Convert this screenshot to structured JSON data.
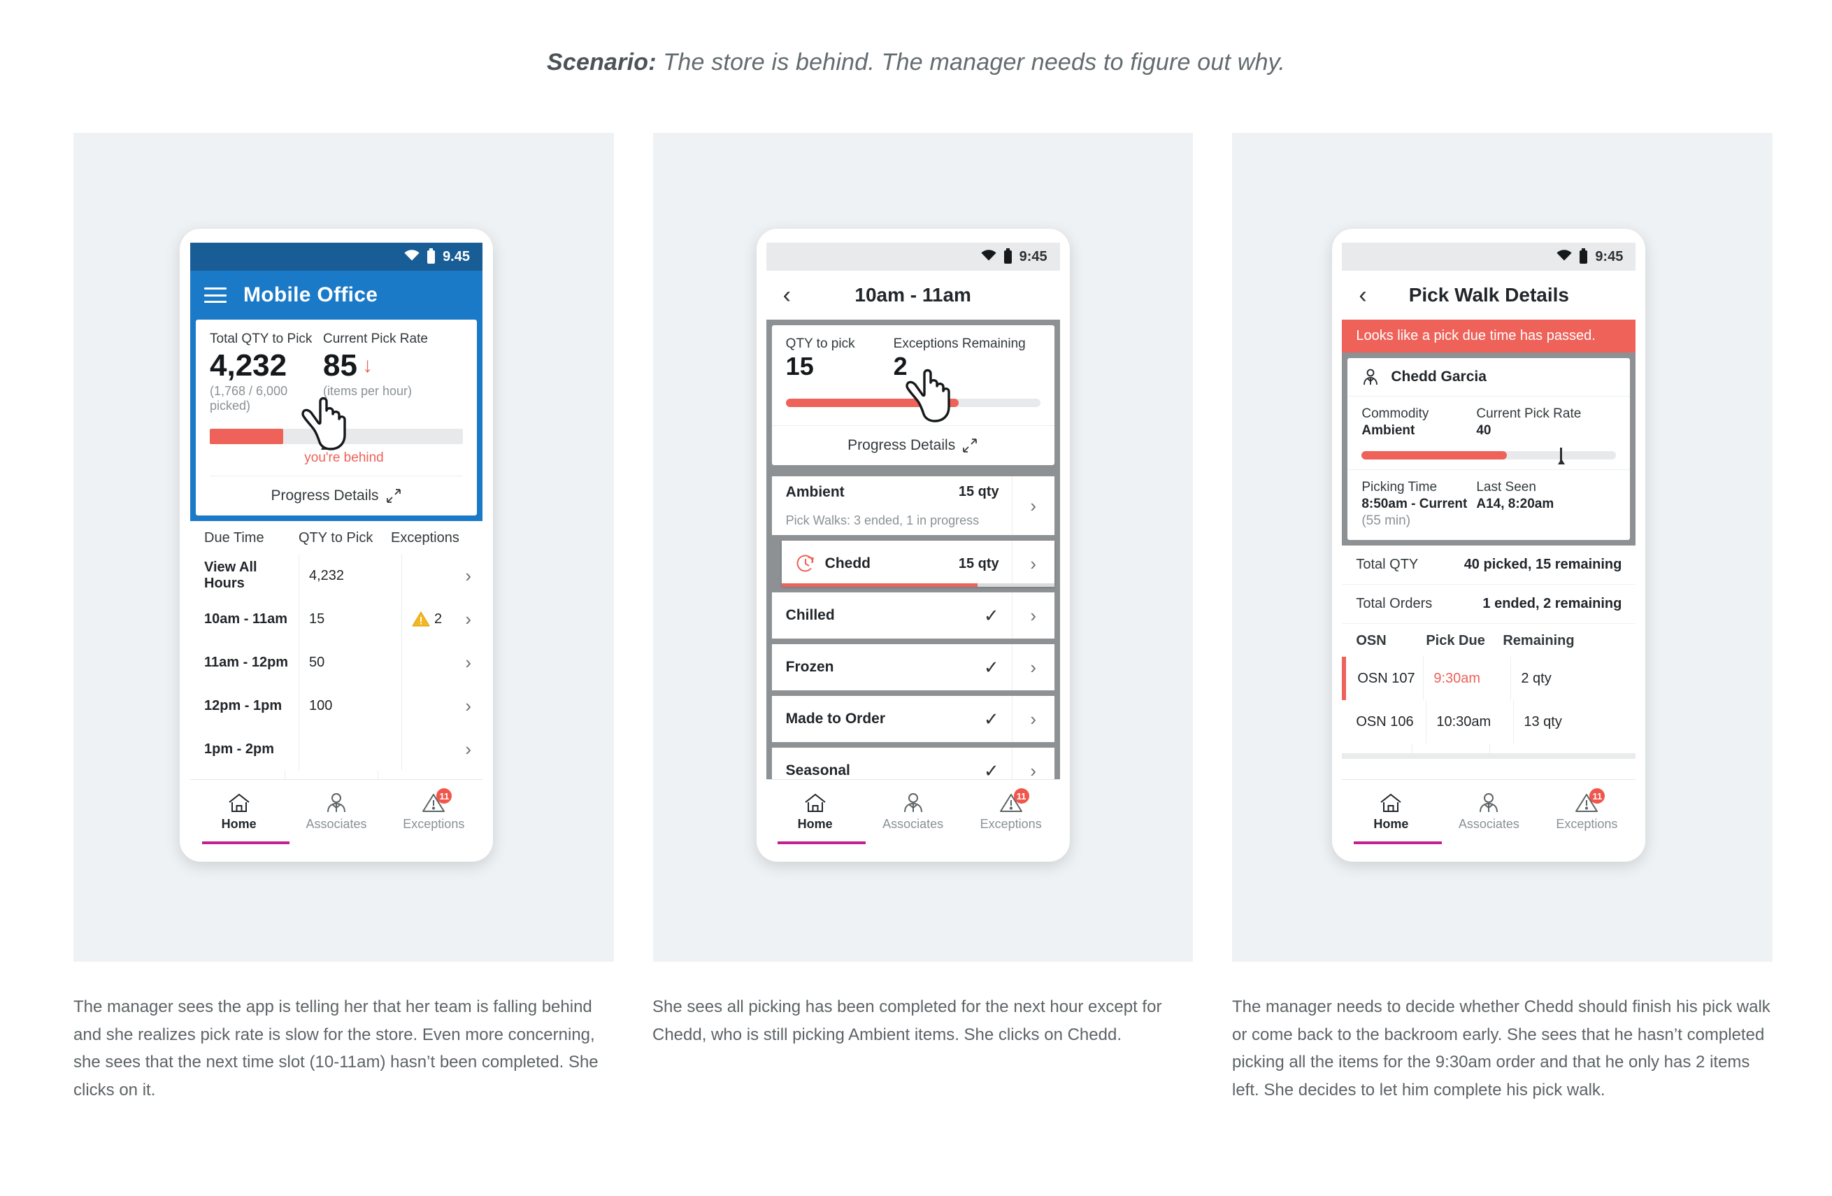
{
  "scenario": {
    "label": "Scenario:",
    "text": "The store is behind. The manager needs to figure out why."
  },
  "phone1": {
    "status": {
      "time": "9.45",
      "wifi_icon": "wifi-icon",
      "battery_icon": "battery-icon"
    },
    "appbar": {
      "menu_icon": "hamburger-menu-icon",
      "title": "Mobile Office"
    },
    "summary": {
      "qty_label": "Total QTY to Pick",
      "qty_value": "4,232",
      "qty_sub": "(1,768 / 6,000 picked)",
      "rate_label": "Current Pick Rate",
      "rate_value": "85",
      "rate_trend_icon": "down-arrow-icon",
      "rate_sub": "(items per hour)",
      "progress_fill_pct": 29,
      "progress_marker_pct": 45,
      "behind_text": "you're behind",
      "progress_details": "Progress Details",
      "expand_icon": "expand-diagonal-icon"
    },
    "table": {
      "headers": [
        "Due Time",
        "QTY to Pick",
        "Exceptions"
      ],
      "rows": [
        {
          "time": "View All Hours",
          "qty": "4,232",
          "exceptions": "",
          "chevron_icon": "chevron-right-icon"
        },
        {
          "time": "10am - 11am",
          "qty": "15",
          "exceptions": "2",
          "exception_icon": "warning-triangle-icon",
          "chevron_icon": "chevron-right-icon"
        },
        {
          "time": "11am - 12pm",
          "qty": "50",
          "exceptions": "",
          "chevron_icon": "chevron-right-icon"
        },
        {
          "time": "12pm - 1pm",
          "qty": "100",
          "exceptions": "",
          "chevron_icon": "chevron-right-icon"
        },
        {
          "time": "1pm - 2pm",
          "qty": "",
          "exceptions": "",
          "chevron_icon": "chevron-right-icon"
        }
      ]
    },
    "bottom_nav": {
      "items": [
        {
          "label": "Home",
          "icon": "home-icon",
          "active": true
        },
        {
          "label": "Associates",
          "icon": "associates-person-icon",
          "active": false
        },
        {
          "label": "Exceptions",
          "icon": "warning-triangle-icon",
          "active": false,
          "badge": "11"
        }
      ]
    },
    "cursor_icon": "pointing-hand-cursor"
  },
  "phone2": {
    "status": {
      "time": "9:45",
      "wifi_icon": "wifi-icon",
      "battery_icon": "battery-icon"
    },
    "navbar": {
      "back_icon": "chevron-left-back-icon",
      "title": "10am - 11am"
    },
    "summary": {
      "qty_label": "QTY to pick",
      "qty_value": "15",
      "exceptions_label": "Exceptions Remaining",
      "exceptions_value": "2",
      "progress_fill_pct": 68,
      "progress_details": "Progress Details",
      "expand_icon": "expand-diagonal-icon"
    },
    "list": [
      {
        "name": "Ambient",
        "sub": "Pick Walks: 3 ended, 1 in progress",
        "qty": "15 qty",
        "done": false,
        "chevron_icon": "chevron-right-icon"
      },
      {
        "name": "Chedd",
        "qty": "15 qty",
        "done": false,
        "icon": "clock-in-progress-icon",
        "highlighted": true,
        "progress_pct": 72,
        "chevron_icon": "chevron-right-icon"
      },
      {
        "name": "Chilled",
        "qty": "",
        "done": true,
        "check_icon": "check-icon",
        "chevron_icon": "chevron-right-icon"
      },
      {
        "name": "Frozen",
        "qty": "",
        "done": true,
        "check_icon": "check-icon",
        "chevron_icon": "chevron-right-icon"
      },
      {
        "name": "Made to Order",
        "qty": "",
        "done": true,
        "check_icon": "check-icon",
        "chevron_icon": "chevron-right-icon"
      },
      {
        "name": "Seasonal",
        "qty": "",
        "done": true,
        "check_icon": "check-icon",
        "chevron_icon": "chevron-right-icon"
      }
    ],
    "bottom_nav": {
      "items": [
        {
          "label": "Home",
          "icon": "home-icon",
          "active": true
        },
        {
          "label": "Associates",
          "icon": "associates-person-icon",
          "active": false
        },
        {
          "label": "Exceptions",
          "icon": "warning-triangle-icon",
          "active": false,
          "badge": "11"
        }
      ]
    },
    "cursor_icon": "pointing-hand-cursor"
  },
  "phone3": {
    "status": {
      "time": "9:45",
      "wifi_icon": "wifi-icon",
      "battery_icon": "battery-icon"
    },
    "navbar": {
      "back_icon": "chevron-left-back-icon",
      "title": "Pick Walk Details"
    },
    "alert": "Looks like a pick due time has passed.",
    "associate": {
      "name": "Chedd Garcia",
      "icon": "associate-avatar-icon"
    },
    "details": {
      "commodity_label": "Commodity",
      "commodity_value": "Ambient",
      "rate_label": "Current Pick Rate",
      "rate_value": "40",
      "progress_fill_pct": 57,
      "progress_marker_pct": 78,
      "picking_time_label": "Picking Time",
      "picking_time_value": "8:50am - Current",
      "picking_time_sub": "(55 min)",
      "last_seen_label": "Last Seen",
      "last_seen_value": "A14, 8:20am"
    },
    "totals": [
      {
        "key": "Total QTY",
        "value": "40 picked, 15 remaining"
      },
      {
        "key": "Total Orders",
        "value": "1 ended, 2 remaining"
      }
    ],
    "osn_table": {
      "headers": [
        "OSN",
        "Pick Due",
        "Remaining"
      ],
      "rows": [
        {
          "osn": "OSN 107",
          "due": "9:30am",
          "remaining": "2 qty",
          "overdue": true
        },
        {
          "osn": "OSN 106",
          "due": "10:30am",
          "remaining": "13 qty",
          "overdue": false
        }
      ]
    },
    "bottom_nav": {
      "items": [
        {
          "label": "Home",
          "icon": "home-icon",
          "active": true
        },
        {
          "label": "Associates",
          "icon": "associates-person-icon",
          "active": false
        },
        {
          "label": "Exceptions",
          "icon": "warning-triangle-icon",
          "active": false,
          "badge": "11"
        }
      ]
    }
  },
  "captions": [
    "The manager sees the app is telling her that her team is falling behind and she realizes pick rate is slow for the store. Even more concerning, she sees that the next time slot (10-11am) hasn’t been completed. She clicks on it.",
    "She sees all picking has been completed for the next hour except for Chedd, who is still picking Ambient items. She clicks on Chedd.",
    "The manager needs to decide whether Chedd should finish his pick walk or come back to the backroom early. She sees that he hasn’t completed picking all the items for the 9:30am order and that he only has 2 items left. She decides to let him complete his pick walk."
  ],
  "colors": {
    "panel_bg": "#eef2f4",
    "brand_blue": "#1a7ac8",
    "status_blue": "#185d95",
    "alert_red": "#ee6259",
    "accent_magenta": "#c2228f",
    "badge_red": "#f0564b",
    "warning_yellow": "#f5b721"
  }
}
